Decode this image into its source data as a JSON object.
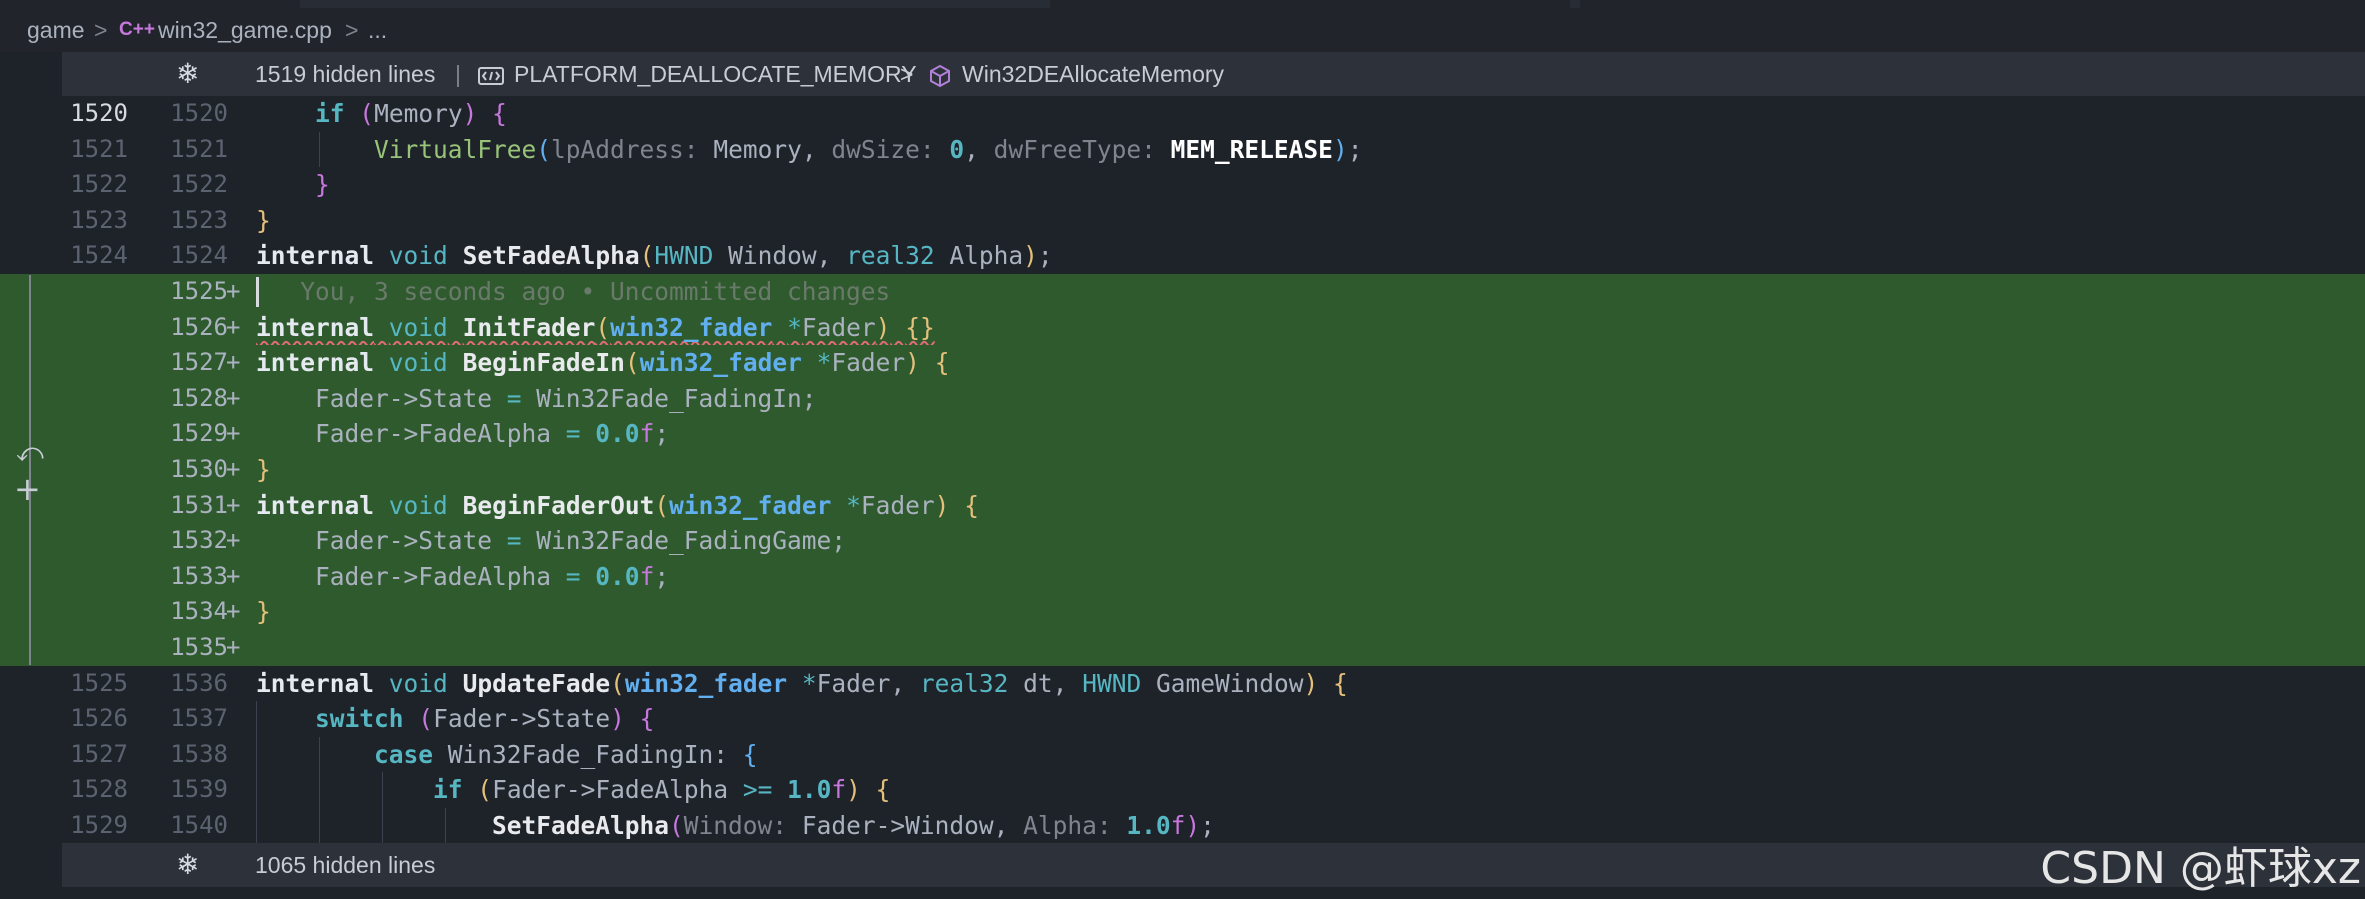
{
  "breadcrumb": {
    "folder": "game",
    "sep1": ">",
    "file_icon": "C++",
    "file": "win32_game.cpp",
    "sep2": ">",
    "ellipsis": "..."
  },
  "top_hidden": {
    "icon": "unfold-icon",
    "count": "1519 hidden lines",
    "divider": "|",
    "symbol1_icon": "macro-icon",
    "symbol1": "PLATFORM_DEALLOCATE_MEMORY",
    "sep": ">",
    "symbol2_icon": "method-cube-icon",
    "symbol2": "Win32DEAllocateMemory"
  },
  "bottom_hidden": {
    "icon": "unfold-icon",
    "count": "1065 hidden lines"
  },
  "gutter": {
    "rows": [
      {
        "old": "1520",
        "new": "1520"
      },
      {
        "old": "1521",
        "new": "1521"
      },
      {
        "old": "1522",
        "new": "1522"
      },
      {
        "old": "1523",
        "new": "1523"
      },
      {
        "old": "1524",
        "new": "1524"
      },
      {
        "old": "",
        "new": "1525",
        "plus": "+"
      },
      {
        "old": "",
        "new": "1526",
        "plus": "+"
      },
      {
        "old": "",
        "new": "1527",
        "plus": "+"
      },
      {
        "old": "",
        "new": "1528",
        "plus": "+"
      },
      {
        "old": "",
        "new": "1529",
        "plus": "+"
      },
      {
        "old": "",
        "new": "1530",
        "plus": "+"
      },
      {
        "old": "",
        "new": "1531",
        "plus": "+"
      },
      {
        "old": "",
        "new": "1532",
        "plus": "+"
      },
      {
        "old": "",
        "new": "1533",
        "plus": "+"
      },
      {
        "old": "",
        "new": "1534",
        "plus": "+"
      },
      {
        "old": "",
        "new": "1535",
        "plus": "+"
      },
      {
        "old": "1525",
        "new": "1536"
      },
      {
        "old": "1526",
        "new": "1537"
      },
      {
        "old": "1527",
        "new": "1538"
      },
      {
        "old": "1528",
        "new": "1539"
      },
      {
        "old": "1529",
        "new": "1540"
      }
    ]
  },
  "blame": "You, 3 seconds ago • Uncommitted changes",
  "diff_actions": {
    "revert_icon": "revert-icon",
    "stage_icon": "plus-icon"
  },
  "watermark": "CSDN @虾球xz"
}
